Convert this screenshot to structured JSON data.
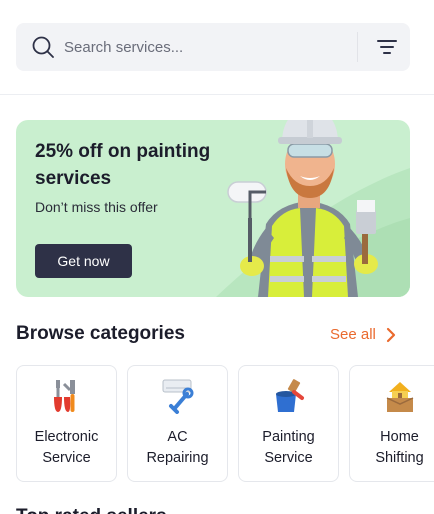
{
  "search": {
    "placeholder": "Search services..."
  },
  "banner": {
    "title": "25% off on painting services",
    "subtitle": "Don’t miss this offer",
    "button_label": "Get now",
    "background_color": "#c9efcf"
  },
  "categories": {
    "heading": "Browse categories",
    "see_all_label": "See all",
    "accent_color": "#ea6a2e",
    "items": [
      {
        "line1": "Electronic",
        "line2": "Service",
        "icon": "electronic-tools-icon"
      },
      {
        "line1": "AC",
        "line2": "Repairing",
        "icon": "ac-repair-icon"
      },
      {
        "line1": "Painting",
        "line2": "Service",
        "icon": "paint-bucket-icon"
      },
      {
        "line1": "Home",
        "line2": "Shifting",
        "icon": "moving-box-house-icon"
      }
    ]
  },
  "next_section": {
    "heading": "Top rated sellers"
  }
}
